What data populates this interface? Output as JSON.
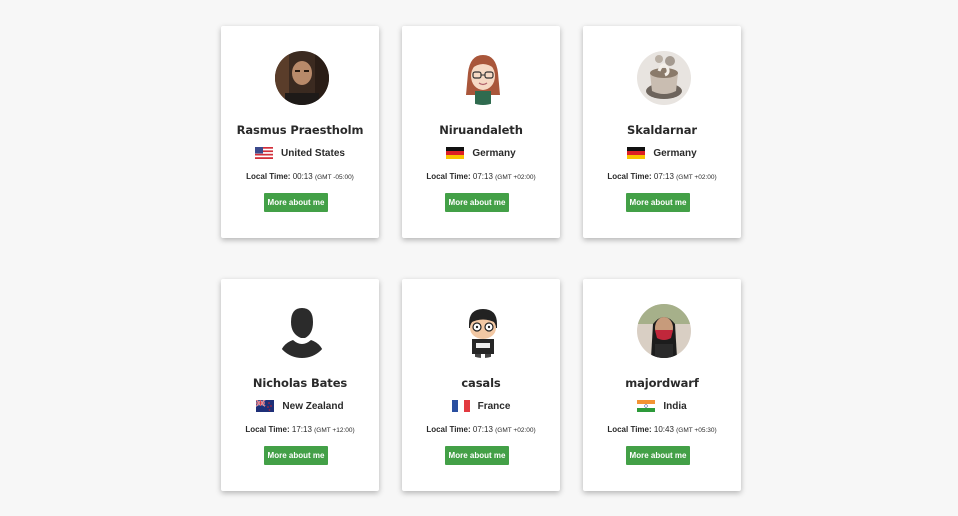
{
  "cards": [
    {
      "name": "Rasmus Praestholm",
      "country": "United States",
      "flag": "us",
      "local_time_label": "Local Time:",
      "time": "00:13",
      "tz": "(GMT -05:00)",
      "button": "More about me",
      "avatar": "photo-bearded-man"
    },
    {
      "name": "Niruandaleth",
      "country": "Germany",
      "flag": "de",
      "local_time_label": "Local Time:",
      "time": "07:13",
      "tz": "(GMT +02:00)",
      "button": "More about me",
      "avatar": "cartoon-woman-glasses"
    },
    {
      "name": "Skaldarnar",
      "country": "Germany",
      "flag": "de",
      "local_time_label": "Local Time:",
      "time": "07:13",
      "tz": "(GMT +02:00)",
      "button": "More about me",
      "avatar": "photo-coffee-cup"
    },
    {
      "name": "Nicholas Bates",
      "country": "New Zealand",
      "flag": "nz",
      "local_time_label": "Local Time:",
      "time": "17:13",
      "tz": "(GMT +12:00)",
      "button": "More about me",
      "avatar": "default-silhouette"
    },
    {
      "name": "casals",
      "country": "France",
      "flag": "fr",
      "local_time_label": "Local Time:",
      "time": "07:13",
      "tz": "(GMT +02:00)",
      "button": "More about me",
      "avatar": "cartoon-man-glasses"
    },
    {
      "name": "majordwarf",
      "country": "India",
      "flag": "in",
      "local_time_label": "Local Time:",
      "time": "10:43",
      "tz": "(GMT +05:30)",
      "button": "More about me",
      "avatar": "photo-woman-mask"
    }
  ]
}
